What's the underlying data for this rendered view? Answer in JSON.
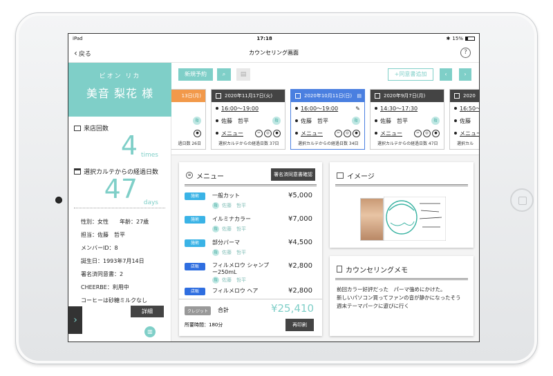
{
  "status": {
    "carrier": "iPad",
    "time": "17:18",
    "battery": "15%"
  },
  "nav": {
    "back_label": "戻る",
    "title": "カウンセリング画面",
    "help_label": "?"
  },
  "customer": {
    "kana": "ビオン リカ",
    "name": "美音 梨花 様",
    "visits_label": "来店回数",
    "visits_value": "4",
    "visits_unit": "times",
    "days_label": "選択カルテからの経過日数",
    "days_value": "47",
    "days_unit": "days",
    "info": {
      "gender": "性別：女性",
      "age": "年齢：27歳",
      "staff": "担当：佐藤　哲平",
      "member_id": "メンバーID：8",
      "birthday": "誕生日：1993年7月14日",
      "consent": "署名済同意書：2",
      "cheerbe": "CHEERBE：利用中",
      "note": "コーヒーは砂糖ミルクなし"
    },
    "detail_button": "詳細"
  },
  "toolbar": {
    "new_booking": "新規予約",
    "add_consent": "+同意書追加"
  },
  "visits": [
    {
      "date": "13日(月)",
      "time": "日",
      "staff": "",
      "menu": "",
      "foot": "過日数 26日",
      "style": "orange"
    },
    {
      "date": "2020年11月17日(火)",
      "time": "16:00～19:00",
      "staff": "佐藤　哲平",
      "menu": "メニュー",
      "foot": "選択カルテからの経過日数 37日",
      "style": "dark"
    },
    {
      "date": "2020年10月11日(日)",
      "time": "16:00～19:00",
      "staff": "佐藤　哲平",
      "menu": "メニュー",
      "foot": "選択カルテからの経過日数 34日",
      "style": "blue"
    },
    {
      "date": "2020年9月7日(月)",
      "time": "14:30～17:30",
      "staff": "佐藤　哲平",
      "menu": "メニュー",
      "foot": "選択カルテからの経過日数 47日",
      "style": "dark"
    },
    {
      "date": "2020",
      "time": "16:50～",
      "staff": "佐藤　",
      "menu": "メニュー",
      "foot": "選択カル",
      "style": "dark"
    }
  ],
  "menu_panel": {
    "title": "メニュー",
    "confirm_button": "署名済同意書確認",
    "items": [
      {
        "tag": "施術",
        "name": "一般カット",
        "price": "¥5,000",
        "staff": "佐藤　哲平"
      },
      {
        "tag": "施術",
        "name": "イルミナカラー",
        "price": "¥7,000",
        "staff": "佐藤　哲平"
      },
      {
        "tag": "施術",
        "name": "部分パーマ",
        "price": "¥4,500",
        "staff": "佐藤　哲平"
      },
      {
        "tag": "店販",
        "name": "フィルメロウ シャンプー250mL",
        "price": "¥2,800",
        "staff": "佐藤　哲平"
      },
      {
        "tag": "店販",
        "name": "フィルメロウ ヘア",
        "price": "¥2,800",
        "staff": ""
      }
    ],
    "payment_tag": "クレジット",
    "total_label": "合計",
    "total_value": "¥25,410",
    "duration": "所要時間：180分",
    "reprint_button": "再印刷"
  },
  "image_panel": {
    "title": "イメージ"
  },
  "memo_panel": {
    "title": "カウンセリングメモ",
    "lines": [
      "前回カラー好評だった　パーマ強めにかけた。",
      "新しいパソコン買ってファンの音が静かになったそう",
      "週末テーマパークに遊びに行く"
    ]
  },
  "icons": {
    "staff_chip": "指"
  },
  "colors": {
    "accent": "#7fcfc8",
    "dark": "#444444",
    "selected": "#4a7fe0",
    "orange": "#f2994a",
    "tag_service": "#3ab3e6",
    "tag_retail": "#2f6ee0"
  }
}
